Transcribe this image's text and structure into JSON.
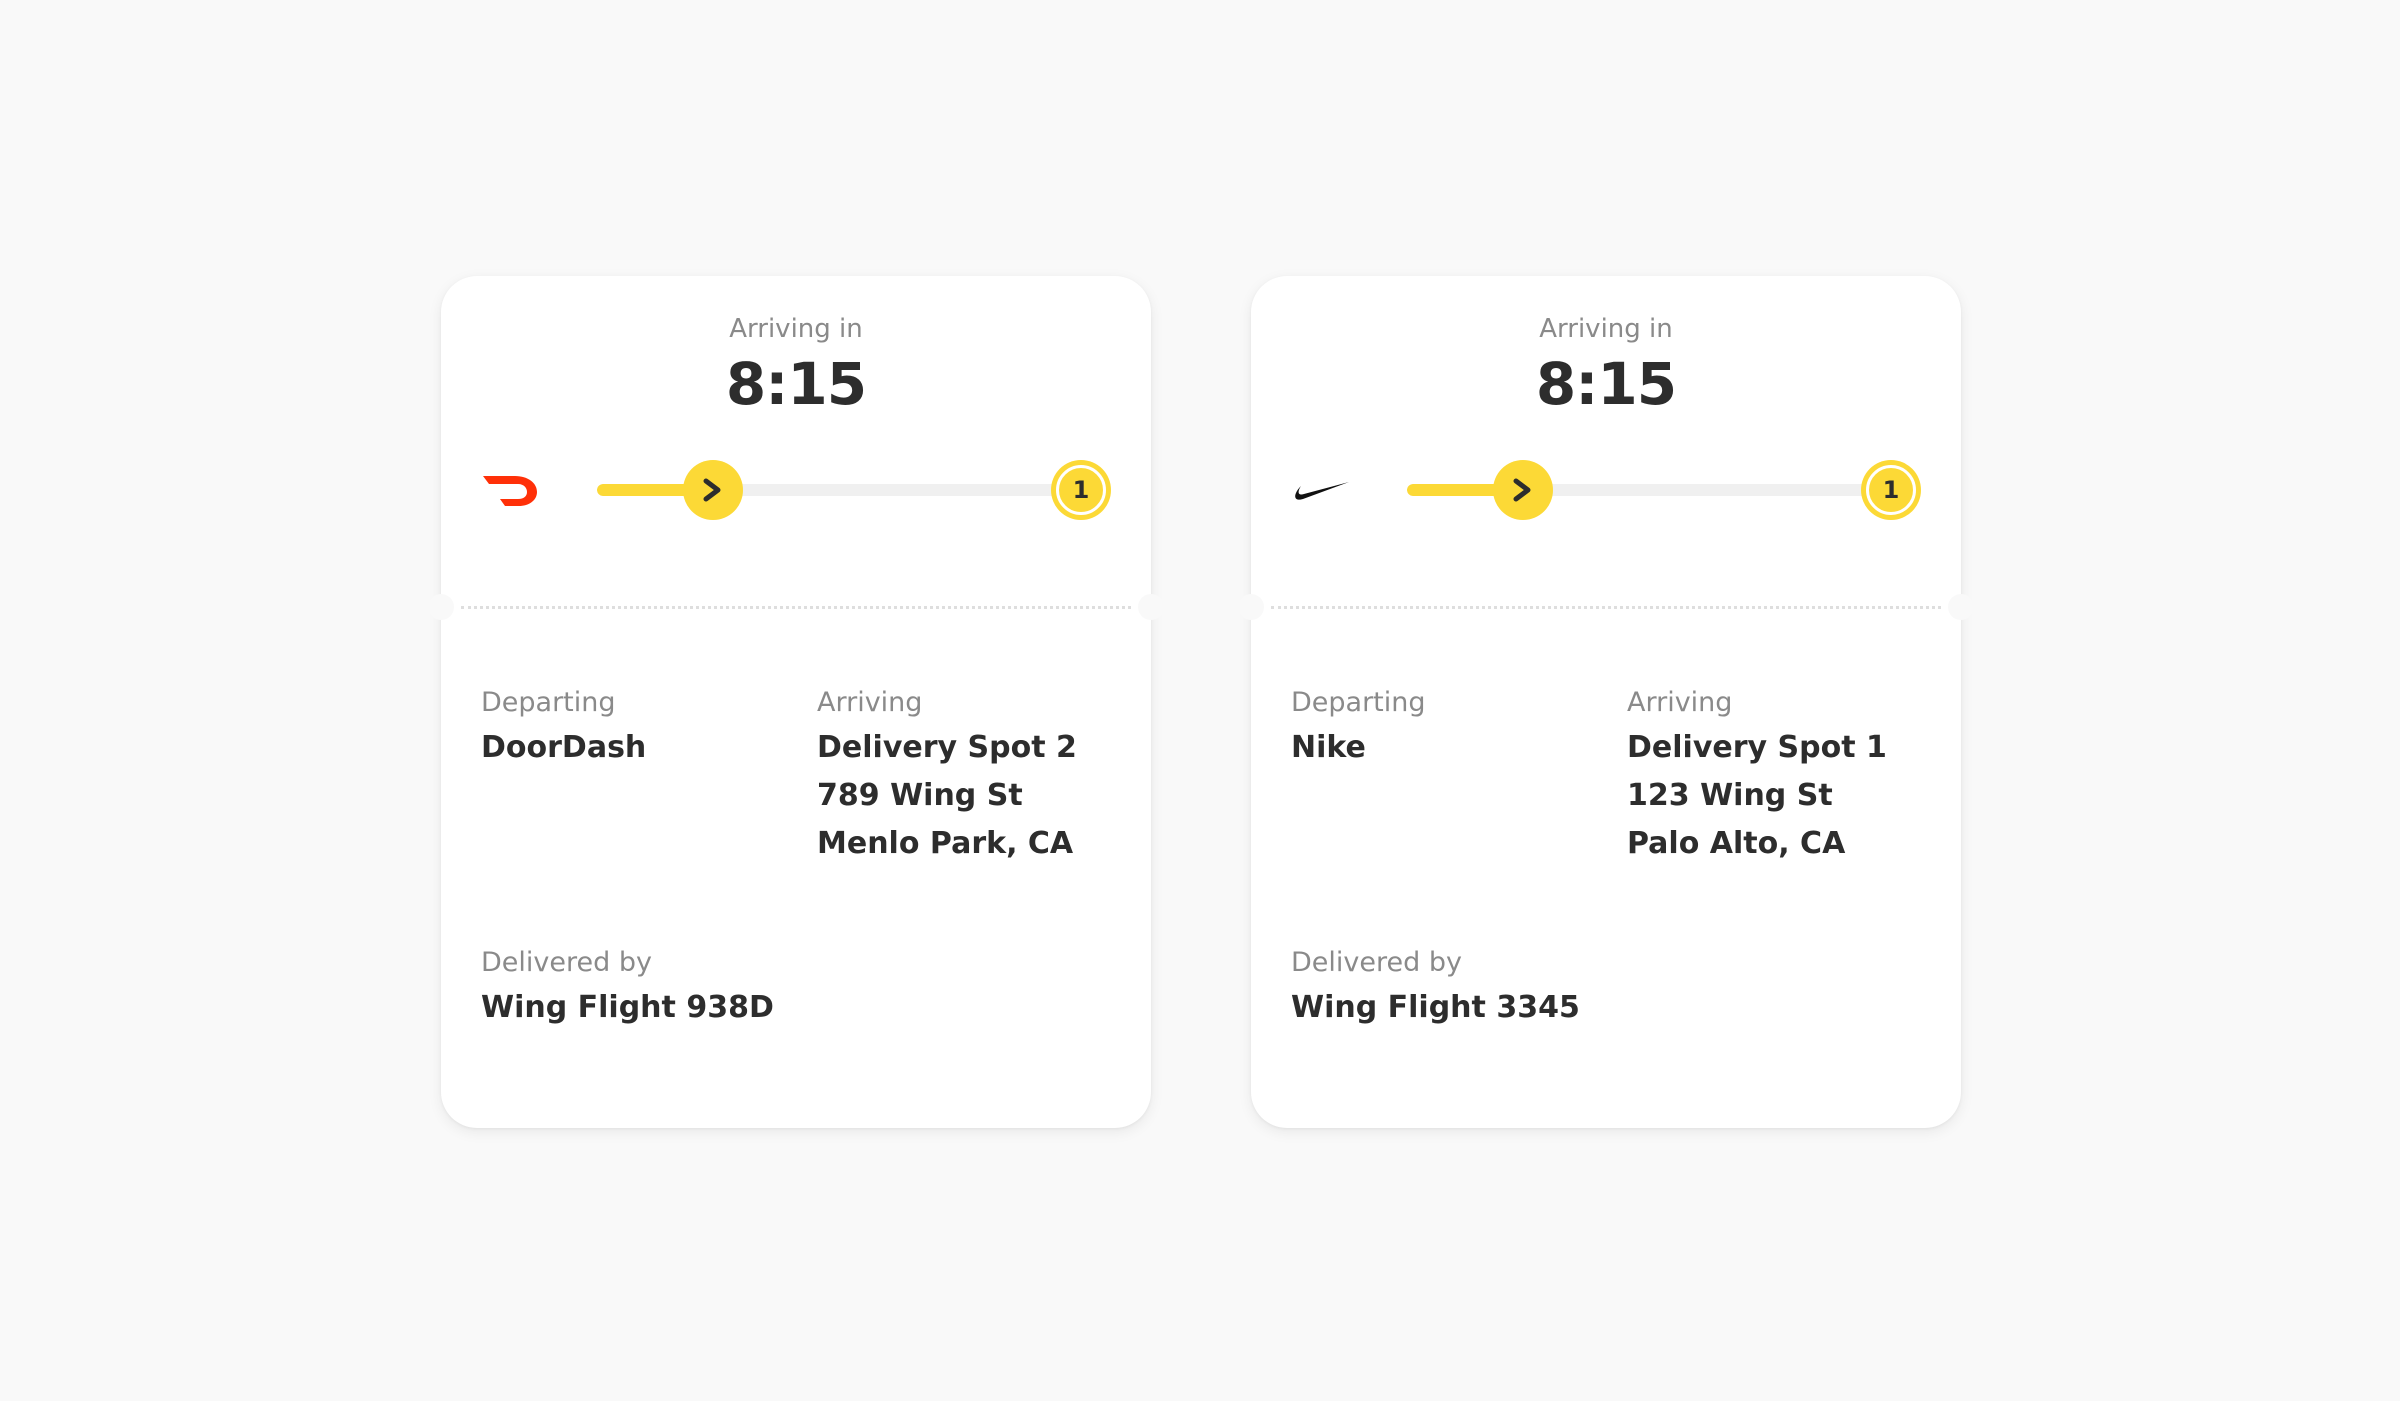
{
  "cards": [
    {
      "brand_icon": "doordash-logo-icon",
      "arriving_label": "Arriving in",
      "arriving_time": "8:15",
      "progress_fraction": 0.25,
      "destination_number": "1",
      "departing": {
        "label": "Departing",
        "value": "DoorDash"
      },
      "arriving": {
        "label": "Arriving",
        "spot": "Delivery Spot 2",
        "street": "789 Wing St",
        "city": "Menlo Park, CA"
      },
      "delivered": {
        "label": "Delivered by",
        "value": "Wing Flight 938D"
      }
    },
    {
      "brand_icon": "nike-swoosh-icon",
      "arriving_label": "Arriving in",
      "arriving_time": "8:15",
      "progress_fraction": 0.25,
      "destination_number": "1",
      "departing": {
        "label": "Departing",
        "value": "Nike"
      },
      "arriving": {
        "label": "Arriving",
        "spot": "Delivery Spot 1",
        "street": "123 Wing St",
        "city": "Palo Alto, CA"
      },
      "delivered": {
        "label": "Delivered by",
        "value": "Wing Flight 3345"
      }
    }
  ],
  "colors": {
    "accent_yellow": "#fcd936",
    "doordash_red": "#ff3008",
    "text_dark": "#2d2d2d",
    "text_muted": "#8a8a8a"
  }
}
